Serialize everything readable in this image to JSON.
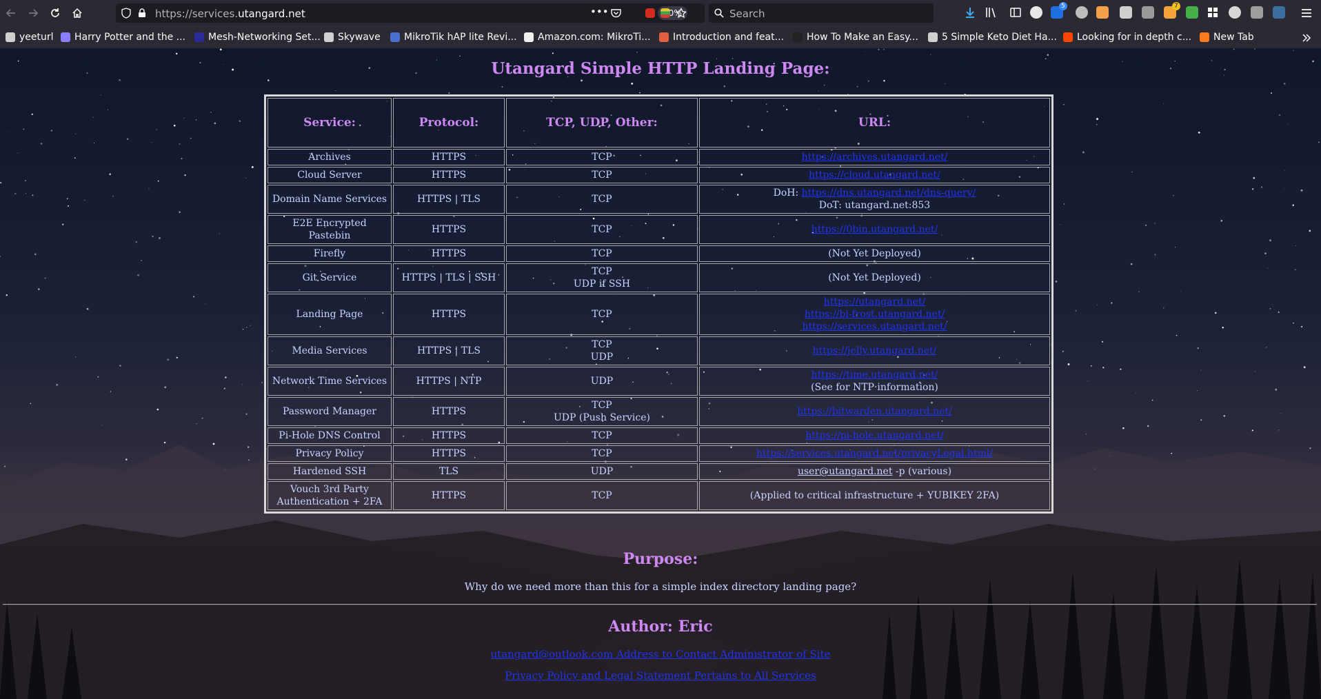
{
  "browser": {
    "url_prefix": "https://services.",
    "url_domain": "utangard.net",
    "zoom": "90%",
    "search_placeholder": "Search",
    "ext_badges": {
      "ublock": "5",
      "notes": "7"
    },
    "icons": {
      "back": "arrow-left-icon",
      "forward": "arrow-right-icon",
      "reload": "reload-icon",
      "home": "home-icon",
      "more": "ellipsis-icon",
      "pocket": "pocket-icon",
      "star": "star-icon",
      "menu": "hamburger-menu-icon"
    },
    "bookmarks": [
      {
        "label": "yeeturl",
        "color": "#cfcfcf"
      },
      {
        "label": "Harry Potter and the ...",
        "color": "#8a7dff"
      },
      {
        "label": "Mesh-Networking Set...",
        "color": "#2a2a9a"
      },
      {
        "label": "Skywave",
        "color": "#d0d0d0"
      },
      {
        "label": "MikroTik hAP lite Revi...",
        "color": "#4a6fcf"
      },
      {
        "label": "Amazon.com: MikroTi...",
        "color": "#f0f0f0"
      },
      {
        "label": "Introduction and feat...",
        "color": "#e06040"
      },
      {
        "label": "How To Make an Easy...",
        "color": "#222222"
      },
      {
        "label": "5 Simple Keto Diet Ha...",
        "color": "#cfcfcf"
      },
      {
        "label": "Looking for in depth c...",
        "color": "#ff4500"
      },
      {
        "label": "New Tab",
        "color": "#ff7a1a"
      }
    ]
  },
  "page": {
    "title": "Utangard Simple HTTP Landing Page:",
    "headers": [
      "Service:",
      "Protocol:",
      "TCP, UDP, Other:",
      "URL:"
    ],
    "rows": [
      {
        "service": [
          "Archives"
        ],
        "protocol": "HTTPS",
        "transport": [
          "TCP"
        ],
        "url": [
          {
            "link": "https://archives.utangard.net/"
          }
        ]
      },
      {
        "service": [
          "Cloud Server"
        ],
        "protocol": "HTTPS",
        "transport": [
          "TCP"
        ],
        "url": [
          {
            "link": "https://cloud.utangard.net/"
          }
        ]
      },
      {
        "service": [
          "Domain Name Services"
        ],
        "protocol": "HTTPS | TLS",
        "transport": [
          "TCP"
        ],
        "url": [
          {
            "prefix": "DoH: ",
            "link": "https://dns.utangard.net/dns-query/"
          },
          {
            "text": "DoT: utangard.net:853"
          }
        ]
      },
      {
        "service": [
          "E2E Encrypted Pastebin"
        ],
        "protocol": "HTTPS",
        "transport": [
          "TCP"
        ],
        "url": [
          {
            "link": "https://0bin.utangard.net/"
          }
        ]
      },
      {
        "service": [
          "Firefly"
        ],
        "protocol": "HTTPS",
        "transport": [
          "TCP"
        ],
        "url": [
          {
            "text": "(Not Yet Deployed)"
          }
        ]
      },
      {
        "service": [
          "Git Service"
        ],
        "protocol": "HTTPS | TLS | SSH",
        "transport": [
          "TCP",
          "UDP if SSH"
        ],
        "url": [
          {
            "text": "(Not Yet Deployed)"
          }
        ]
      },
      {
        "service": [
          "Landing Page"
        ],
        "protocol": "HTTPS",
        "transport": [
          "TCP"
        ],
        "url": [
          {
            "link": "https://utangard.net/"
          },
          {
            "link": "https://bi-frost.utangard.net/"
          },
          {
            "link": "https://services.utangard.net/"
          }
        ]
      },
      {
        "service": [
          "Media Services"
        ],
        "protocol": "HTTPS | TLS",
        "transport": [
          "TCP",
          "UDP"
        ],
        "url": [
          {
            "link": "https://jelly.utangard.net/"
          }
        ]
      },
      {
        "service": [
          "Network Time Services"
        ],
        "protocol": "HTTPS | NTP",
        "transport": [
          "UDP"
        ],
        "url": [
          {
            "link": "https://time.utangard.net/"
          },
          {
            "text": "(See for NTP information)"
          }
        ]
      },
      {
        "service": [
          "Password Manager"
        ],
        "protocol": "HTTPS",
        "transport": [
          "TCP",
          "UDP (Push Service)"
        ],
        "url": [
          {
            "link": "https://bitwarden.utangard.net/"
          }
        ]
      },
      {
        "service": [
          "Pi-Hole DNS Control"
        ],
        "protocol": "HTTPS",
        "transport": [
          "TCP"
        ],
        "url": [
          {
            "link": "https://pi-hole.utangard.net/"
          }
        ]
      },
      {
        "service": [
          "Privacy Policy"
        ],
        "protocol": "HTTPS",
        "transport": [
          "TCP"
        ],
        "url": [
          {
            "link": "https://services.utangard.net/privacyLegal.html/"
          }
        ]
      },
      {
        "service": [
          "Hardened SSH"
        ],
        "protocol": "TLS",
        "transport": [
          "UDP"
        ],
        "url": [
          {
            "mail": "user@utangard.net",
            "suffix": " -p (various)"
          }
        ]
      },
      {
        "service": [
          "Vouch 3rd Party",
          "Authentication + 2FA"
        ],
        "protocol": "HTTPS",
        "transport": [
          "TCP"
        ],
        "url": [
          {
            "text": "(Applied to critical infrastructure + YUBIKEY 2FA)"
          }
        ]
      }
    ],
    "purpose_title": "Purpose:",
    "purpose_text": "Why do we need more than this for a simple index directory landing page?",
    "author_title": "Author: Eric",
    "footer_links": [
      "utangard@outlook.com Address to Contact Administrator of Site",
      "Privacy Policy and Legal Statement Pertains to All Services"
    ]
  }
}
